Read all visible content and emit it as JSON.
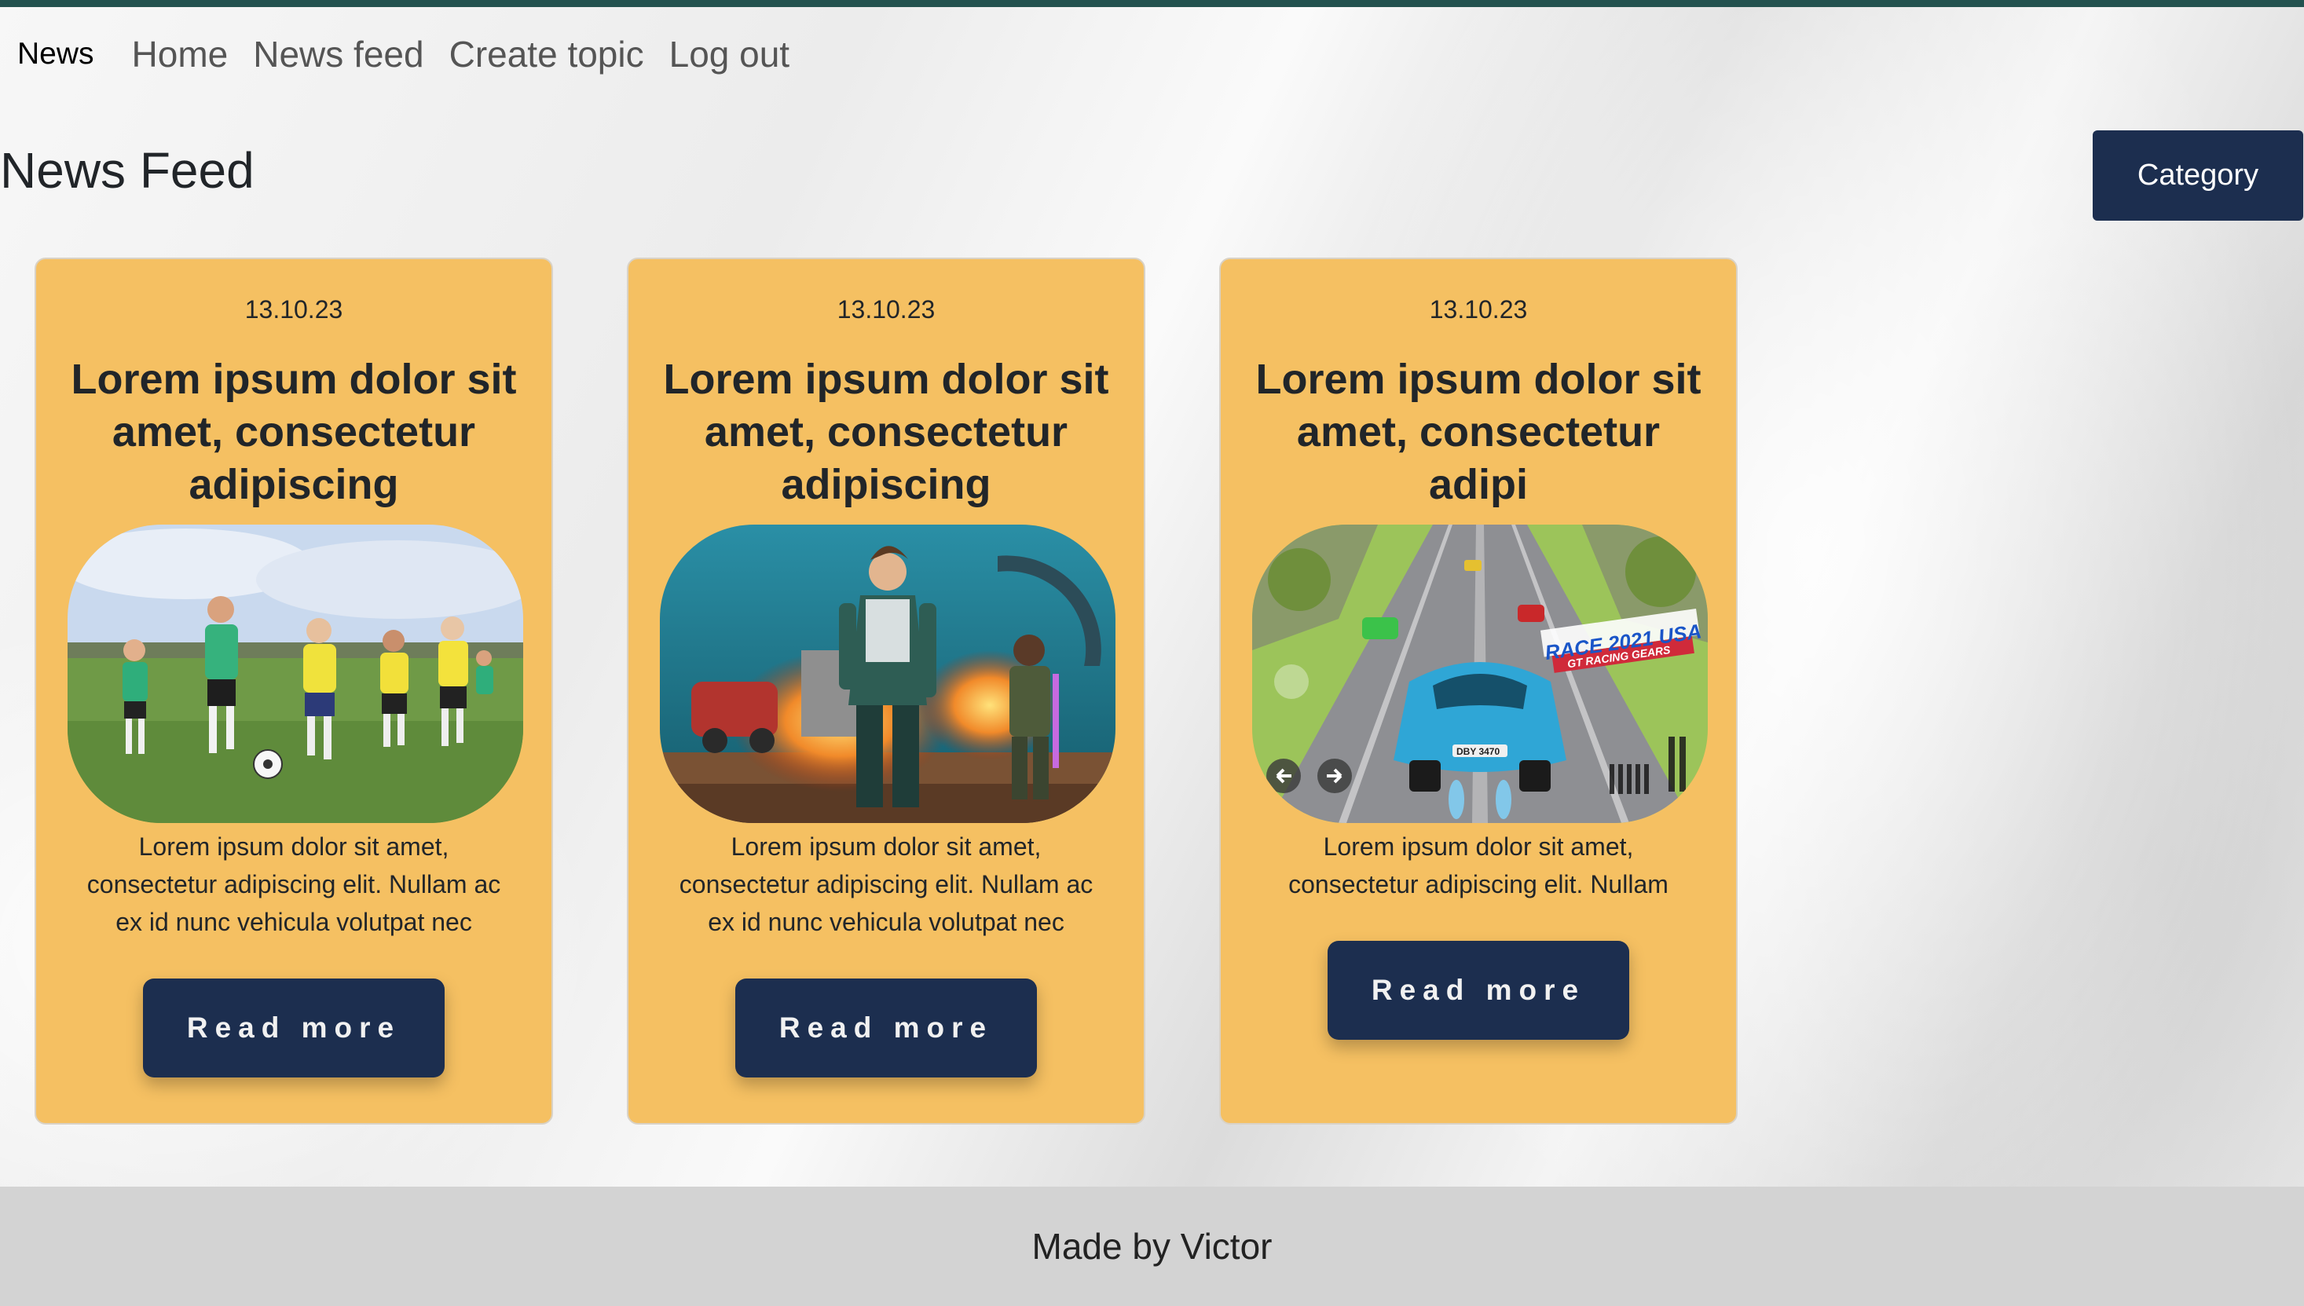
{
  "nav": {
    "brand": "News",
    "links": [
      "Home",
      "News feed",
      "Create topic",
      "Log out"
    ]
  },
  "page": {
    "title": "News Feed",
    "category_button": "Category"
  },
  "cards": [
    {
      "date": "13.10.23",
      "title": "Lorem ipsum dolor sit amet, consectetur adipiscing",
      "text": "Lorem ipsum dolor sit amet, consectetur adipiscing elit. Nullam ac ex id nunc vehicula volutpat nec",
      "button": "Read more",
      "image": "kids-soccer-photo"
    },
    {
      "date": "13.10.23",
      "title": "Lorem ipsum dolor sit amet, consectetur adipiscing",
      "text": "Lorem ipsum dolor sit amet, consectetur adipiscing elit. Nullam ac ex id nunc vehicula volutpat nec",
      "button": "Read more",
      "image": "video-game-characters-art"
    },
    {
      "date": "13.10.23",
      "title": "Lorem ipsum dolor sit amet, consectetur adipi",
      "text": "Lorem ipsum dolor sit amet, consectetur adipiscing elit. Nullam",
      "button": "Read more",
      "image": "racing-game-screenshot",
      "image_text": {
        "banner_line1": "RACE 2021 USA",
        "banner_line2": "GT RACING GEARS",
        "plate": "DBY 3470"
      }
    }
  ],
  "footer": {
    "text": "Made by Victor"
  },
  "colors": {
    "top_bar": "#23524f",
    "card_bg": "#f5c062",
    "button_bg": "#1c2e4f",
    "footer_bg": "#d3d3d3"
  }
}
